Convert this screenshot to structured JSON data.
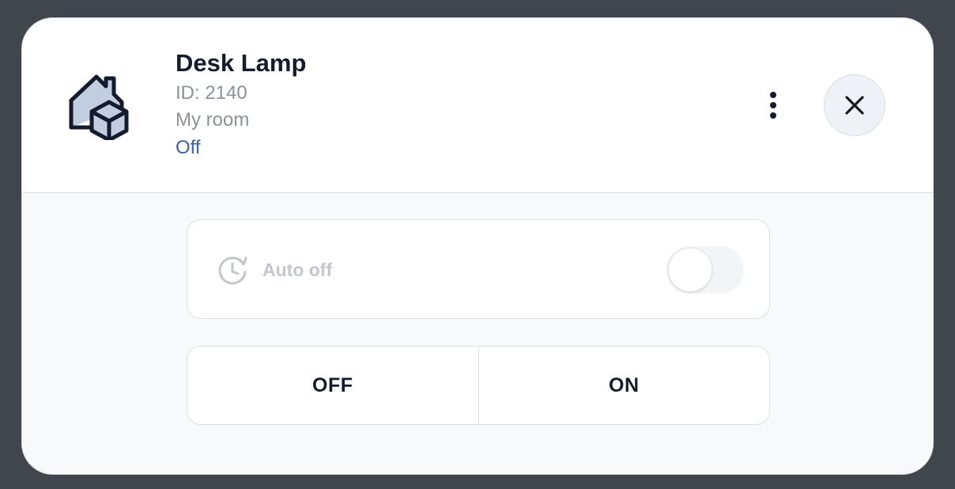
{
  "device": {
    "name": "Desk Lamp",
    "id_text": "ID: 2140",
    "room": "My room",
    "state": "Off",
    "icon": "house-box-icon"
  },
  "header": {
    "more_icon": "more-vertical-icon",
    "close_icon": "close-icon"
  },
  "auto_off": {
    "label": "Auto off",
    "icon": "timer-icon",
    "enabled": false
  },
  "power": {
    "off_label": "OFF",
    "on_label": "ON"
  },
  "colors": {
    "backdrop": "#41454c",
    "title": "#141b2d",
    "muted": "#8c919a",
    "state_accent": "#3e5fa6",
    "icon_fill": "#c3cde0"
  }
}
